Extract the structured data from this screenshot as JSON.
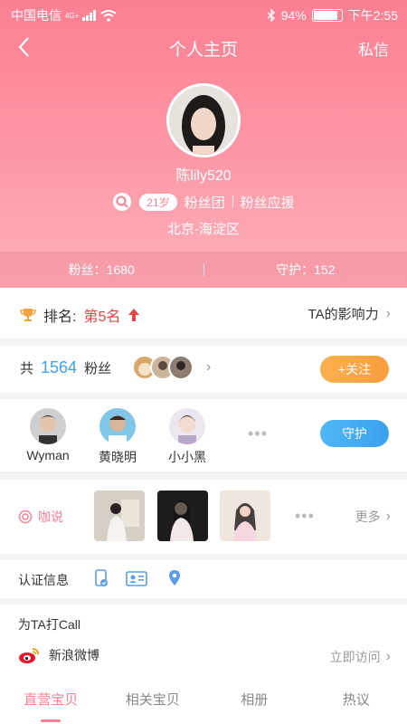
{
  "status_bar": {
    "carrier": "中国电信",
    "network": "4G+",
    "battery": "94%",
    "battery_level": 0.94,
    "time": "下午2:55"
  },
  "nav": {
    "title": "个人主页",
    "message_label": "私信"
  },
  "profile": {
    "username": "陈lily520",
    "age": "21岁",
    "fan_club": "粉丝团",
    "fan_support": "粉丝应援",
    "location": "北京-海淀区"
  },
  "stats": {
    "fans": "粉丝：1680",
    "guard": "守护：152"
  },
  "rank": {
    "label": "排名:",
    "value": "第5名",
    "influence": "TA的影响力"
  },
  "fans_row": {
    "prefix": "共",
    "count": "1564",
    "suffix": "粉丝",
    "follow_label": "+关注"
  },
  "guard_row": {
    "members": [
      {
        "name": "Wyman"
      },
      {
        "name": "黄晓明"
      },
      {
        "name": "小小黑"
      }
    ],
    "guard_label": "守护"
  },
  "talk_row": {
    "label": "咖说",
    "more": "更多"
  },
  "cert_row": {
    "label": "认证信息"
  },
  "call_row": {
    "title": "为TA打Call",
    "weibo": "新浪微博",
    "visit": "立即访问"
  },
  "tabs": [
    {
      "label": "直营宝贝"
    },
    {
      "label": "相关宝贝"
    },
    {
      "label": "相册"
    },
    {
      "label": "热议"
    }
  ],
  "colors": {
    "accent": "#fb7f92",
    "orange": "#f99d3d",
    "blue": "#3aa2ee",
    "rank_red": "#e64545"
  }
}
